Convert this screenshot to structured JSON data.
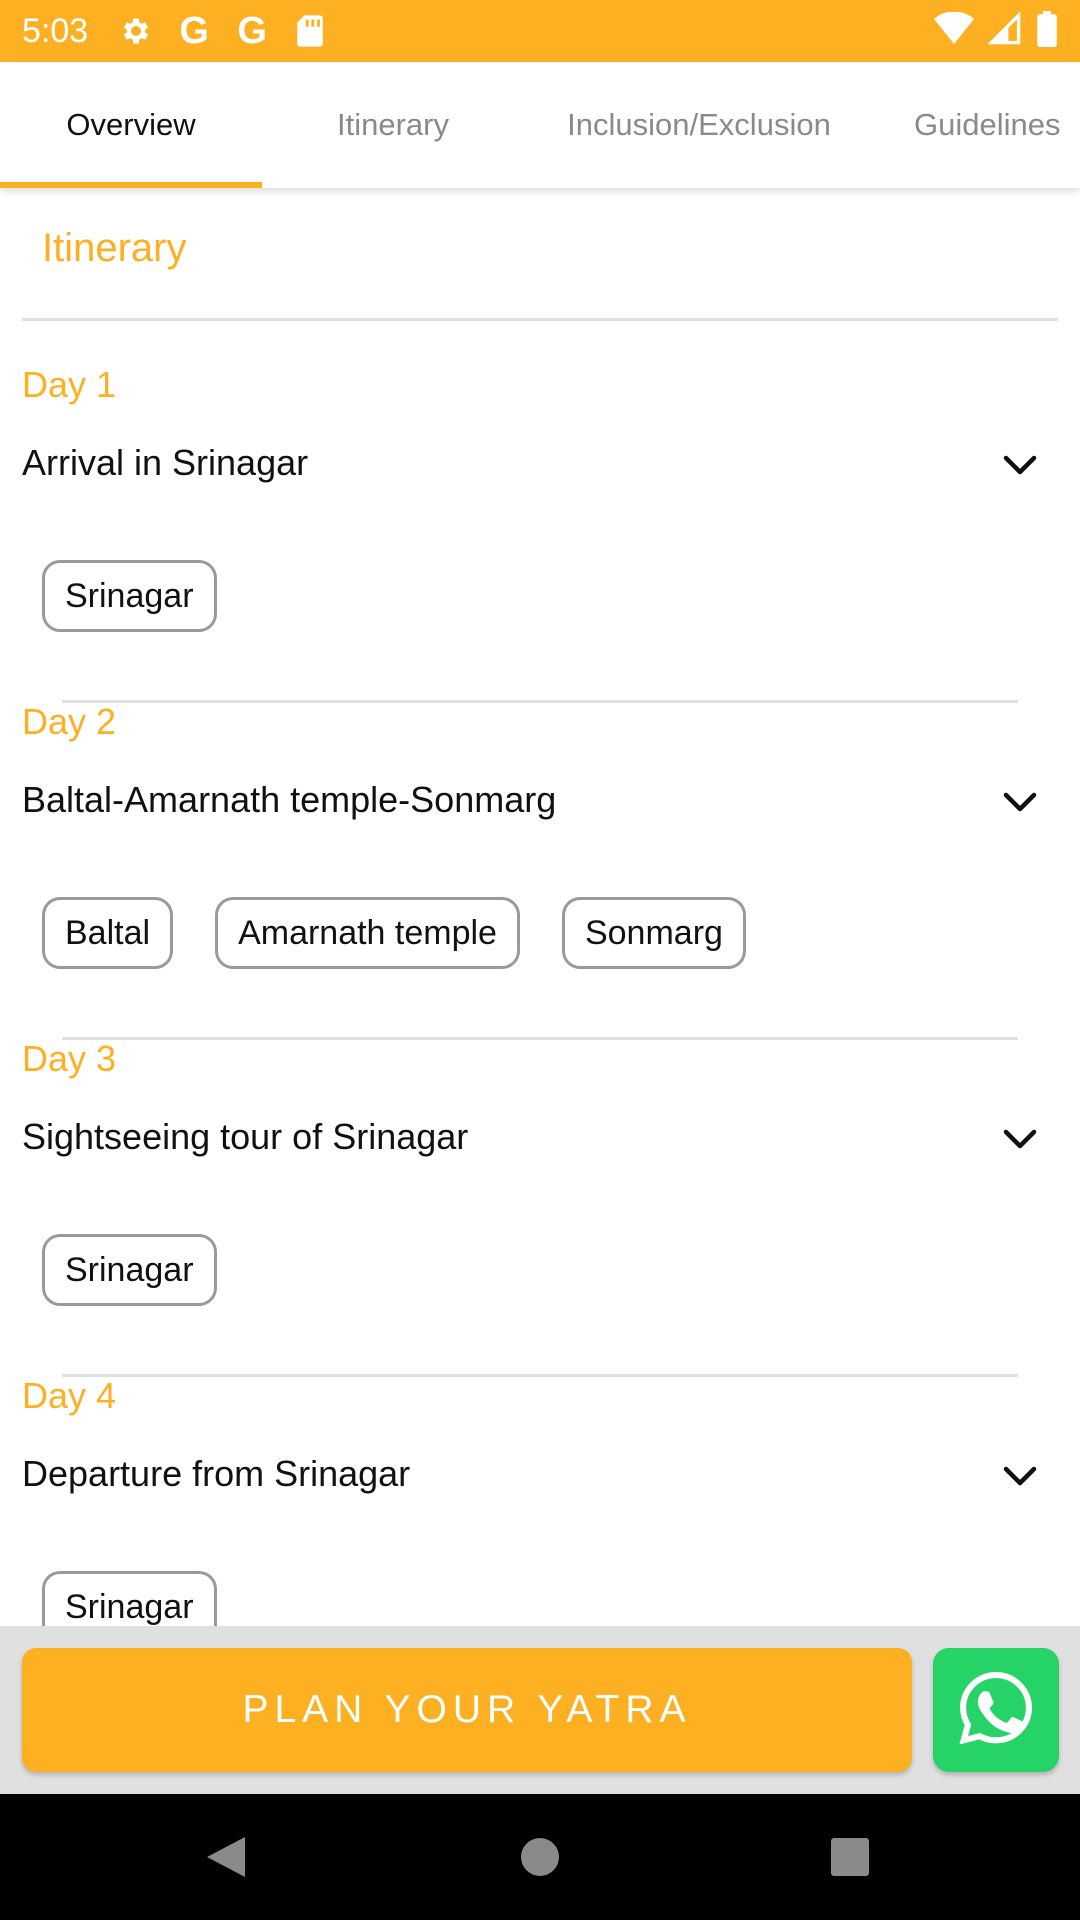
{
  "status_bar": {
    "time": "5:03",
    "left_icons": [
      "gear-icon",
      "google-icon",
      "google-icon",
      "sd-card-icon"
    ],
    "right_icons": [
      "wifi-icon",
      "signal-icon",
      "battery-icon"
    ],
    "color": "#FDB022"
  },
  "tabs": [
    {
      "label": "Overview",
      "active": true
    },
    {
      "label": "Itinerary",
      "active": false
    },
    {
      "label": "Inclusion/Exclusion",
      "active": false
    },
    {
      "label": "Guidelines",
      "active": false
    }
  ],
  "section": {
    "title": "Itinerary"
  },
  "days": [
    {
      "label": "Day 1",
      "title": "Arrival in Srinagar",
      "places": [
        "Srinagar"
      ]
    },
    {
      "label": "Day 2",
      "title": "Baltal-Amarnath temple-Sonmarg",
      "places": [
        "Baltal",
        "Amarnath temple",
        "Sonmarg"
      ]
    },
    {
      "label": "Day 3",
      "title": "Sightseeing tour of Srinagar",
      "places": [
        "Srinagar"
      ]
    },
    {
      "label": "Day 4",
      "title": "Departure from Srinagar",
      "places": [
        "Srinagar"
      ]
    }
  ],
  "action_bar": {
    "plan_label": "PLAN YOUR YATRA",
    "whatsapp_icon": "whatsapp-icon"
  },
  "colors": {
    "accent": "#FDB022",
    "whatsapp": "#25D366"
  },
  "nav_bar": {
    "icons": [
      "back-icon",
      "home-icon",
      "recents-icon"
    ]
  }
}
